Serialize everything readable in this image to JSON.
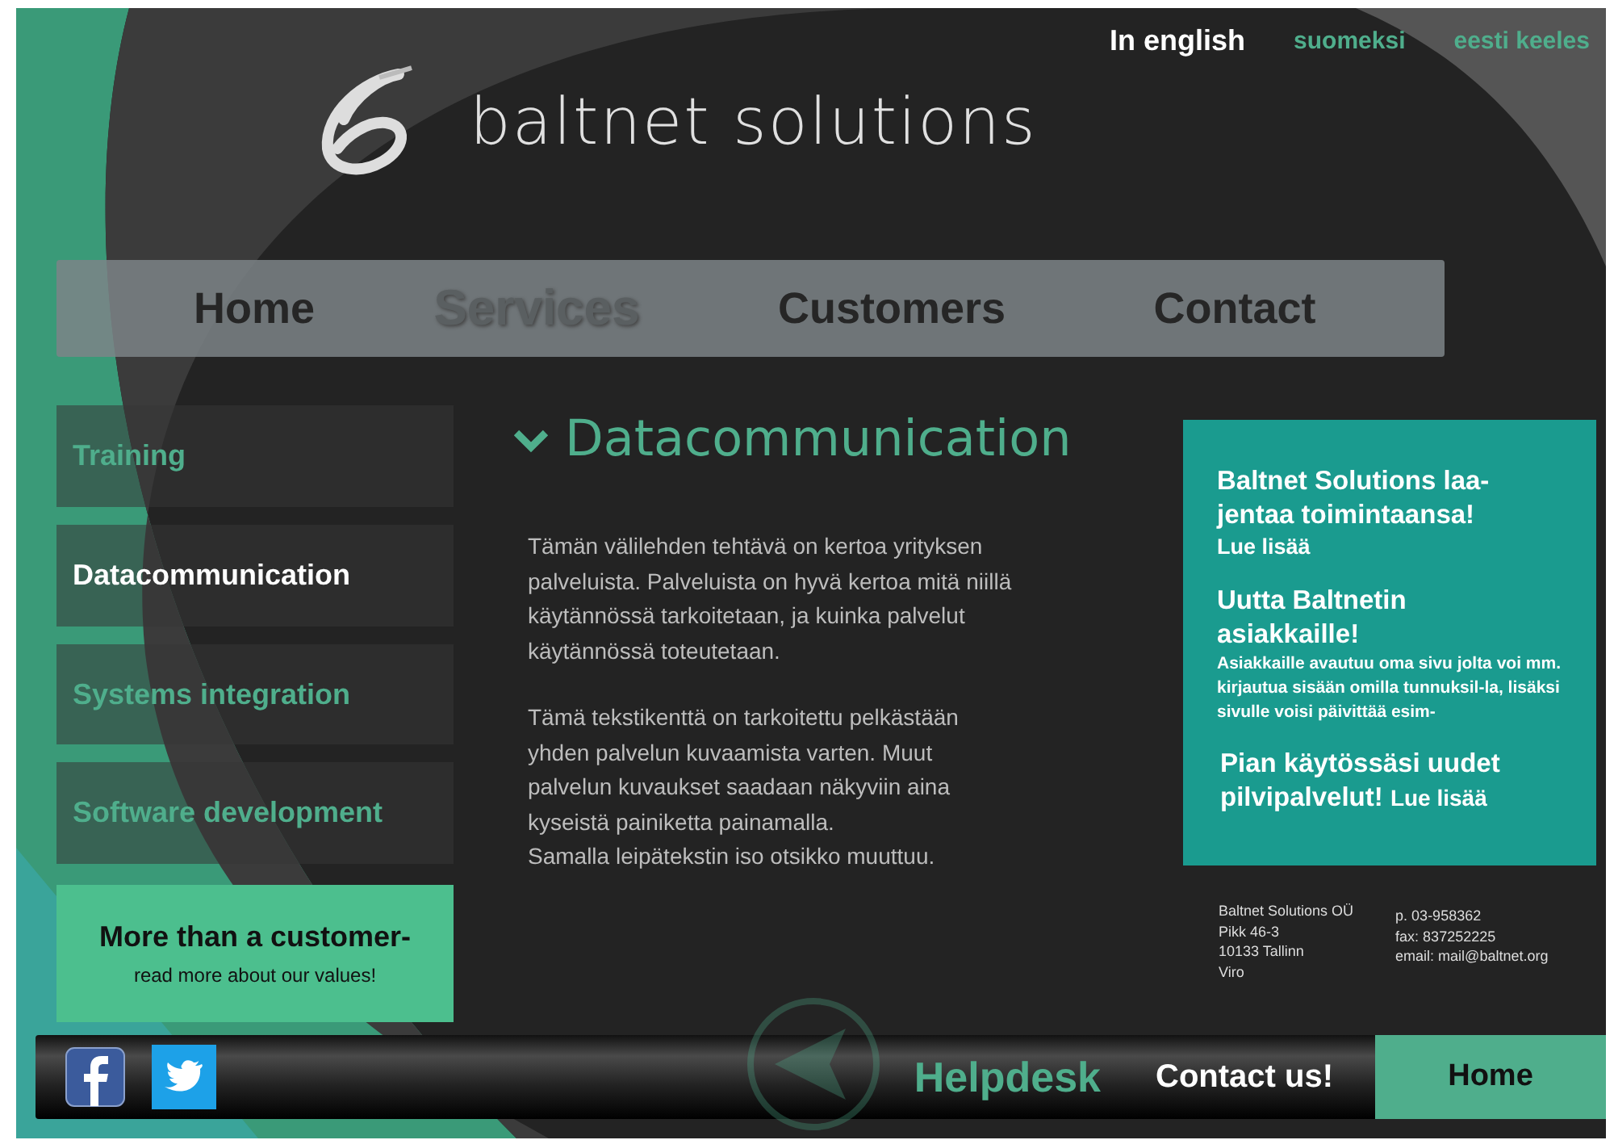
{
  "languages": [
    {
      "label": "In english",
      "selected": true
    },
    {
      "label": "suomeksi",
      "selected": false
    },
    {
      "label": "eesti keeles",
      "selected": false
    }
  ],
  "logo": {
    "text": "baltnet solutions"
  },
  "nav": [
    {
      "label": "Home",
      "selected": false
    },
    {
      "label": "Services",
      "selected": true
    },
    {
      "label": "Customers",
      "selected": false
    },
    {
      "label": "Contact",
      "selected": false
    }
  ],
  "sidebar": {
    "items": [
      {
        "label": "Training",
        "selected": false
      },
      {
        "label": "Datacommunication",
        "selected": true
      },
      {
        "label": "Systems integration",
        "selected": false
      },
      {
        "label": "Software development",
        "selected": false
      }
    ],
    "promo": {
      "title": "More than a customer-",
      "link": "read more about our values!"
    }
  },
  "article": {
    "heading": "Datacommunication",
    "paragraphs": [
      "Tämän välilehden tehtävä on kertoa yrityksen palveluista. Palveluista on hyvä kertoa mitä niillä käytännössä tarkoitetaan, ja kuinka palvelut käytännössä toteutetaan.",
      "Tämä tekstikenttä on tarkoitettu pelkästään yhden palvelun kuvaamista varten. Muut palvelun kuvaukset saadaan näkyviin aina kyseistä painiketta painamalla.\nSamalla leipätekstin iso otsikko muuttuu."
    ]
  },
  "news": [
    {
      "title": "Baltnet Solutions laa-jentaa toimintaansa!",
      "link": "Lue lisää",
      "kind": "link"
    },
    {
      "title": "Uutta Baltnetin asiakkaille!",
      "body": "Asiakkaille avautuu oma sivu jolta voi mm. kirjautua sisään omilla tunnuksil-la, lisäksi sivulle voisi päivittää esim-",
      "kind": "body"
    },
    {
      "title": "Pian käytössäsi uudet pilvipalvelut!",
      "link": "Lue lisää",
      "kind": "inline-link"
    }
  ],
  "address": {
    "column_1": [
      "Baltnet Solutions OÜ",
      "Pikk 46-3",
      "10133 Tallinn",
      "Viro"
    ],
    "column_2": [
      "p. 03-958362",
      "fax: 837252225",
      "email: mail@baltnet.org"
    ]
  },
  "footer": {
    "helpdesk": "Helpdesk",
    "contact": "Contact us!",
    "home": "Home"
  }
}
